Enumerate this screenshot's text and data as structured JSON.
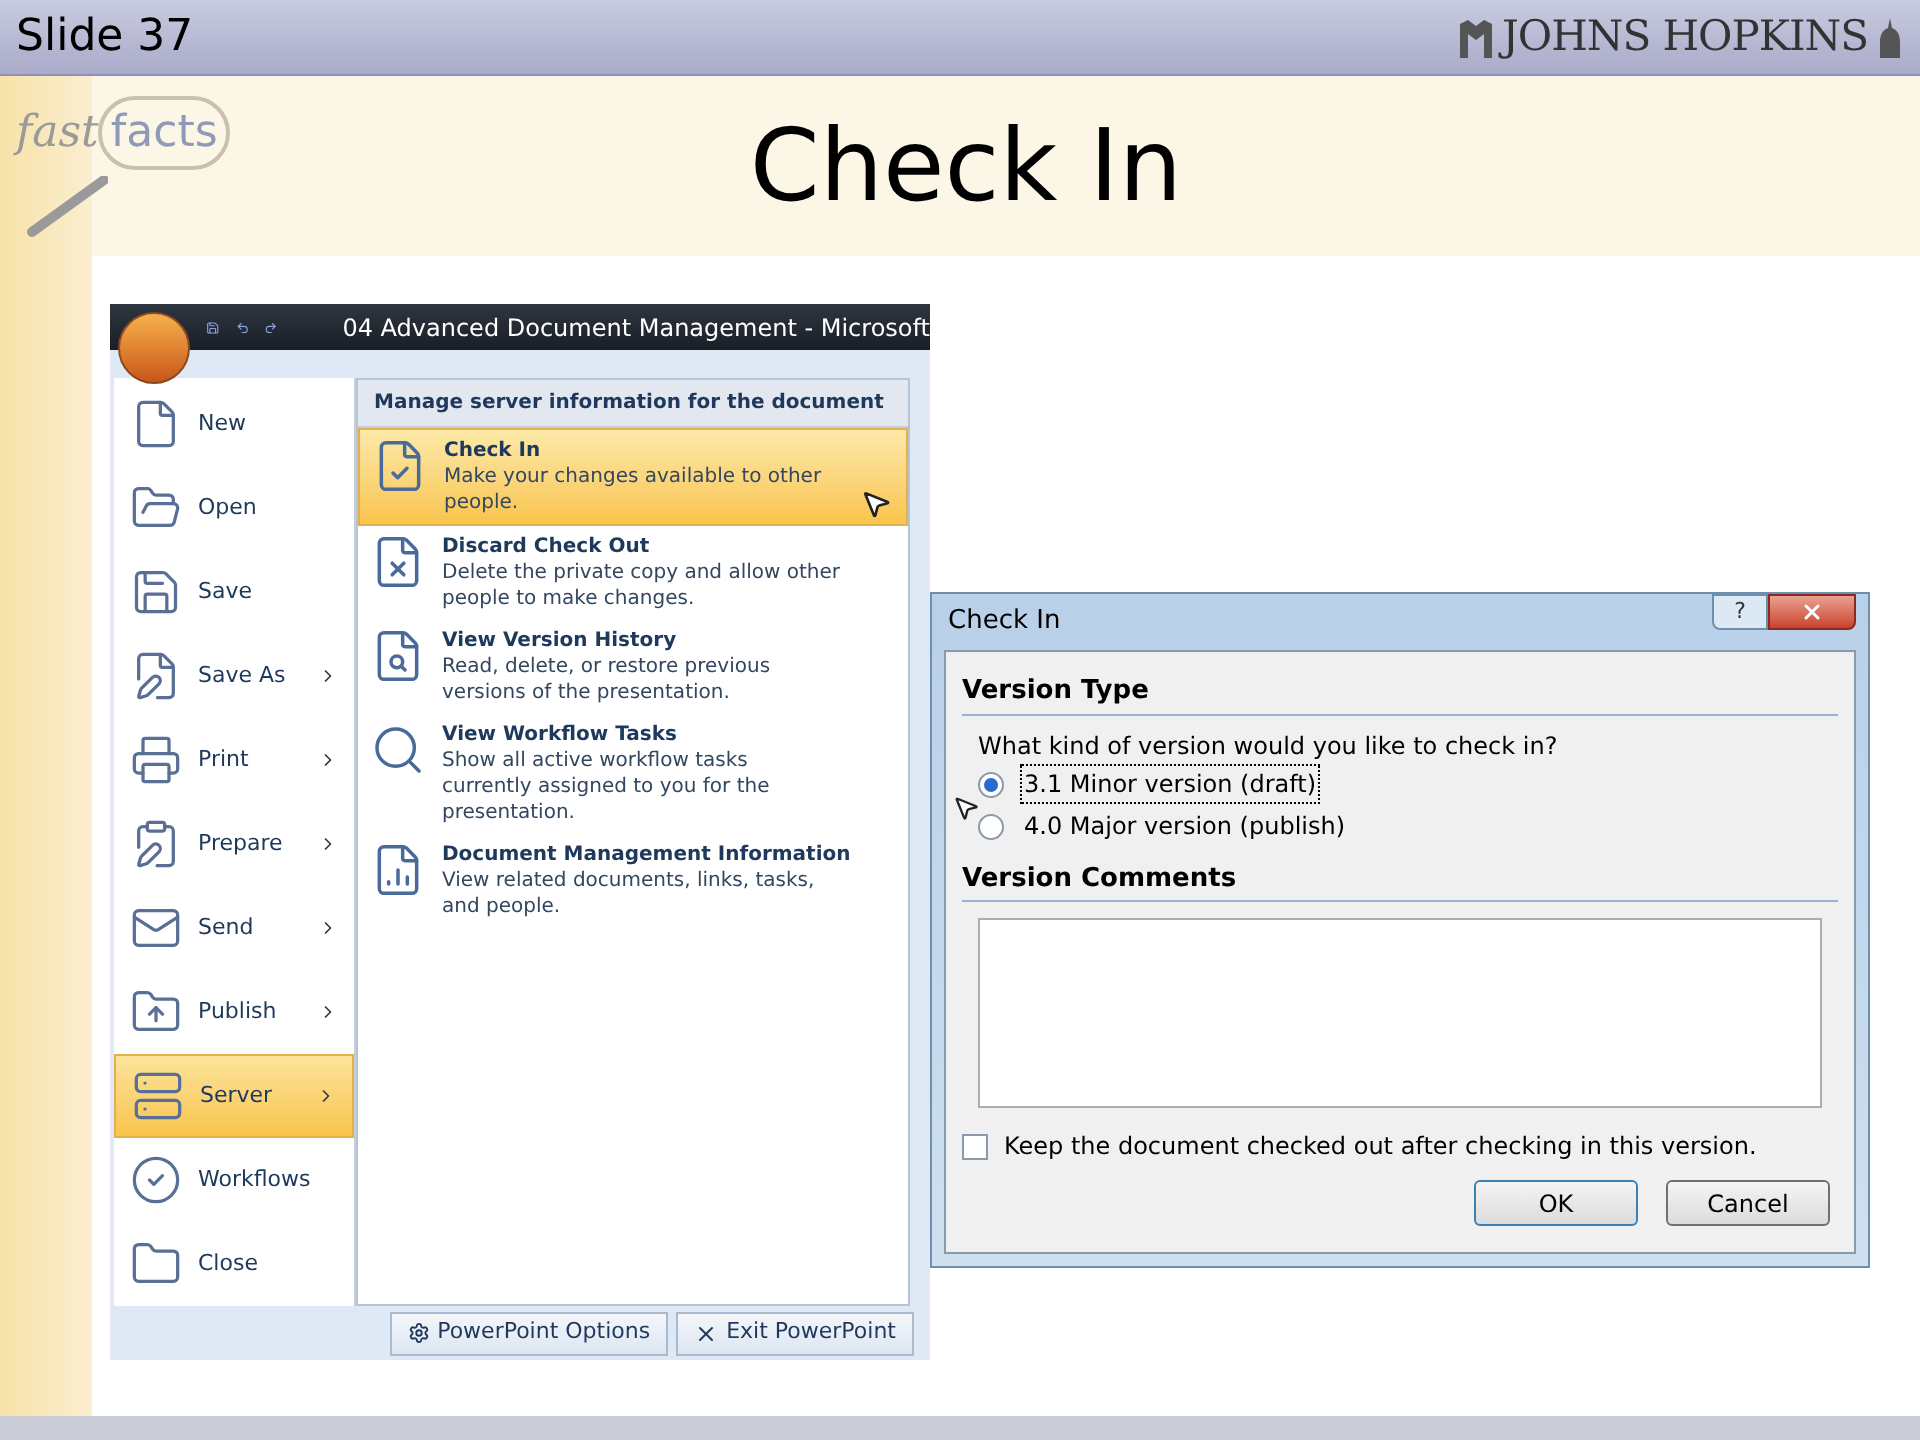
{
  "slide": {
    "number": "Slide 37",
    "brand": "JOHNS HOPKINS",
    "logo_text": [
      "fast",
      "facts"
    ],
    "title": "Check In"
  },
  "office_menu": {
    "window_title": "04 Advanced Document Management - Microsoft",
    "items": [
      {
        "label": "New",
        "submenu": false,
        "selected": false
      },
      {
        "label": "Open",
        "submenu": false,
        "selected": false
      },
      {
        "label": "Save",
        "submenu": false,
        "selected": false
      },
      {
        "label": "Save As",
        "submenu": true,
        "selected": false
      },
      {
        "label": "Print",
        "submenu": true,
        "selected": false
      },
      {
        "label": "Prepare",
        "submenu": true,
        "selected": false
      },
      {
        "label": "Send",
        "submenu": true,
        "selected": false
      },
      {
        "label": "Publish",
        "submenu": true,
        "selected": false
      },
      {
        "label": "Server",
        "submenu": true,
        "selected": true
      },
      {
        "label": "Workflows",
        "submenu": false,
        "selected": false
      },
      {
        "label": "Close",
        "submenu": false,
        "selected": false
      }
    ],
    "panel_heading": "Manage server information for the document",
    "panel_items": [
      {
        "title": "Check In",
        "description": "Make your changes available to other people.",
        "selected": true
      },
      {
        "title": "Discard Check Out",
        "description": "Delete the private copy and allow other people to make changes.",
        "selected": false
      },
      {
        "title": "View Version History",
        "description": "Read, delete, or restore previous versions of the presentation.",
        "selected": false
      },
      {
        "title": "View Workflow Tasks",
        "description": "Show all active workflow tasks currently assigned to you for the presentation.",
        "selected": false
      },
      {
        "title": "Document Management Information",
        "description": "View related documents, links, tasks, and people.",
        "selected": false
      }
    ],
    "buttons": [
      "PowerPoint Options",
      "Exit PowerPoint"
    ]
  },
  "dialog": {
    "title": "Check In",
    "help": "?",
    "section_1": "Version Type",
    "question": "What kind of version would you like to check in?",
    "options": [
      {
        "label": "3.1 Minor version (draft)",
        "selected": true
      },
      {
        "label": "4.0 Major version (publish)",
        "selected": false
      }
    ],
    "section_2": "Version Comments",
    "keep_checked_out": {
      "label": "Keep the document checked out after checking in this version.",
      "checked": false
    },
    "buttons": [
      "OK",
      "Cancel"
    ]
  }
}
